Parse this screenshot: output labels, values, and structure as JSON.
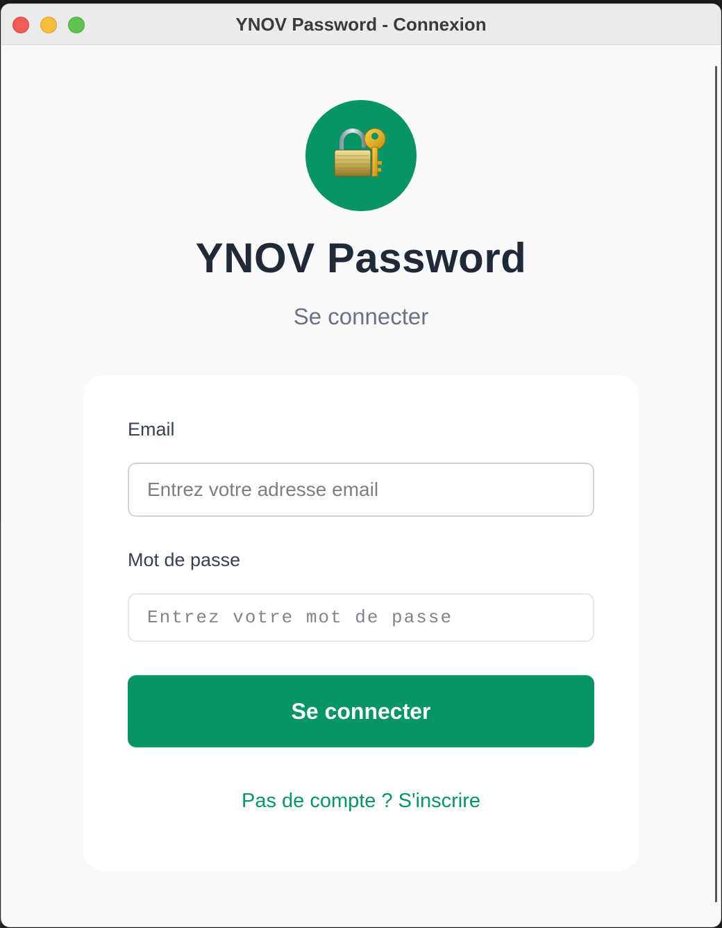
{
  "window": {
    "title": "YNOV Password - Connexion"
  },
  "logo": {
    "icon": "lock-with-key-icon",
    "background_color": "#079467"
  },
  "header": {
    "app_title": "YNOV Password",
    "subtitle": "Se connecter"
  },
  "form": {
    "email_label": "Email",
    "email_placeholder": "Entrez votre adresse email",
    "email_value": "",
    "password_label": "Mot de passe",
    "password_placeholder": "Entrez votre mot de passe",
    "password_value": "",
    "submit_label": "Se connecter",
    "signup_link": "Pas de compte ? S'inscrire"
  },
  "colors": {
    "accent": "#079467",
    "title_text": "#1f2937",
    "muted_text": "#6b7280"
  }
}
